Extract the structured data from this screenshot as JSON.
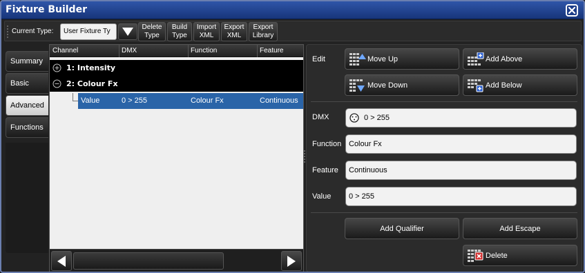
{
  "window": {
    "title": "Fixture Builder"
  },
  "toolbar": {
    "current_type_label": "Current Type:",
    "current_type_value": "User Fixture Ty",
    "buttons": [
      {
        "line1": "Delete",
        "line2": "Type"
      },
      {
        "line1": "Build",
        "line2": "Type"
      },
      {
        "line1": "Import",
        "line2": "XML"
      },
      {
        "line1": "Export",
        "line2": "XML"
      },
      {
        "line1": "Export",
        "line2": "Library"
      }
    ]
  },
  "tabs": [
    {
      "label": "Summary",
      "active": false
    },
    {
      "label": "Basic",
      "active": false
    },
    {
      "label": "Advanced",
      "active": true
    },
    {
      "label": "Functions",
      "active": false
    }
  ],
  "tree": {
    "columns": [
      "Channel",
      "DMX",
      "Function",
      "Feature"
    ],
    "groups": [
      {
        "label": "1: Intensity",
        "expander": "plus"
      },
      {
        "label": "2: Colour Fx",
        "expander": "minus"
      }
    ],
    "selected_row": {
      "channel": "Value",
      "dmx": "0 > 255",
      "function": "Colour Fx",
      "feature": "Continuous"
    }
  },
  "edit": {
    "label": "Edit",
    "move_up": "Move Up",
    "move_down": "Move Down",
    "add_above": "Add Above",
    "add_below": "Add Below"
  },
  "details": {
    "dmx_label": "DMX",
    "dmx_value": "0 > 255",
    "function_label": "Function",
    "function_value": "Colour Fx",
    "feature_label": "Feature",
    "feature_value": "Continuous",
    "value_label": "Value",
    "value_value": "0 > 255"
  },
  "actions": {
    "add_qualifier": "Add Qualifier",
    "add_escape": "Add Escape",
    "delete": "Delete"
  },
  "colors": {
    "title_bar": "#2f55a8",
    "selection": "#2a64a8",
    "delete_accent": "#d23030",
    "add_accent": "#2a5fd0"
  }
}
